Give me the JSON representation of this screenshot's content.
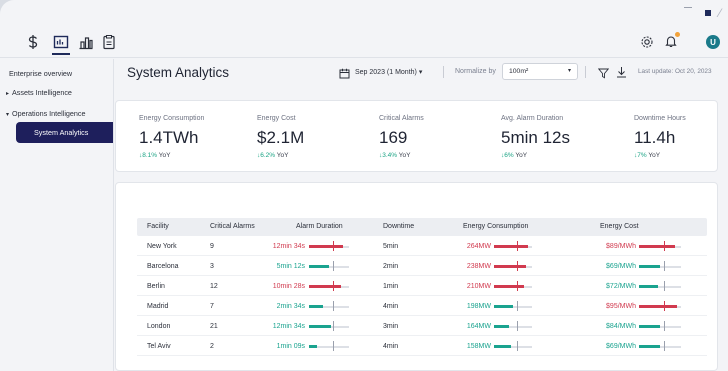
{
  "window": {
    "controls": {
      "close_glyph": "⁄"
    }
  },
  "nav": {
    "icons": [
      "dollar-icon",
      "dashboard-icon",
      "building-icon",
      "clipboard-icon"
    ],
    "active": "dashboard-icon",
    "avatar_initial": "U"
  },
  "sidebar": {
    "items": [
      {
        "label": "Enterprise overview"
      },
      {
        "label": "Assets Intelligence",
        "caret": "▸"
      },
      {
        "label": "Operations Intelligence",
        "caret": "▾"
      },
      {
        "label": "System Analytics",
        "active": true
      }
    ]
  },
  "header": {
    "title": "System Analytics",
    "date_range": "Sep 2023 (1 Month)",
    "date_caret": "▾",
    "normalize_label": "Normalize by",
    "normalize_value": "100m²",
    "normalize_caret": "▾",
    "last_update": "Last update: Oct 20, 2023"
  },
  "kpis": [
    {
      "label": "Energy Consumption",
      "value": "1.4TWh",
      "delta": "↓8.1%",
      "suffix": "YoY"
    },
    {
      "label": "Energy Cost",
      "value": "$2.1M",
      "delta": "↓6.2%",
      "suffix": "YoY"
    },
    {
      "label": "Critical Alarms",
      "value": "169",
      "delta": "↓3.4%",
      "suffix": "YoY"
    },
    {
      "label": "Avg. Alarm Duration",
      "value": "5min 12s",
      "delta": "↓6%",
      "suffix": "YoY"
    },
    {
      "label": "Downtime Hours",
      "value": "11.4h",
      "delta": "↓7%",
      "suffix": "YoY"
    }
  ],
  "table": {
    "columns": [
      "Facility",
      "Critical Alarms",
      "Alarm Duration",
      "Downtime",
      "Energy Consumption",
      "Energy Cost"
    ],
    "rows": [
      {
        "facility": "New York",
        "alarms": "9",
        "duration": "12min 34s",
        "duration_status": "bad",
        "duration_level": 0.85,
        "downtime": "5min",
        "energy": "264MW",
        "energy_status": "bad",
        "energy_level": 0.9,
        "cost": "$89/MWh",
        "cost_status": "bad",
        "cost_level": 0.85
      },
      {
        "facility": "Barcelona",
        "alarms": "3",
        "duration": "5min 12s",
        "duration_status": "good",
        "duration_level": 0.5,
        "downtime": "2min",
        "energy": "238MW",
        "energy_status": "bad",
        "energy_level": 0.85,
        "cost": "$69/MWh",
        "cost_status": "good",
        "cost_level": 0.5
      },
      {
        "facility": "Berlin",
        "alarms": "12",
        "duration": "10min 28s",
        "duration_status": "bad",
        "duration_level": 0.8,
        "downtime": "1min",
        "energy": "210MW",
        "energy_status": "bad",
        "energy_level": 0.8,
        "cost": "$72/MWh",
        "cost_status": "good",
        "cost_level": 0.45
      },
      {
        "facility": "Madrid",
        "alarms": "7",
        "duration": "2min 34s",
        "duration_status": "good",
        "duration_level": 0.35,
        "downtime": "4min",
        "energy": "198MW",
        "energy_status": "good",
        "energy_level": 0.5,
        "cost": "$95/MWh",
        "cost_status": "bad",
        "cost_level": 0.9
      },
      {
        "facility": "London",
        "alarms": "21",
        "duration": "12min 34s",
        "duration_status": "good",
        "duration_level": 0.55,
        "downtime": "3min",
        "energy": "164MW",
        "energy_status": "good",
        "energy_level": 0.4,
        "cost": "$84/MWh",
        "cost_status": "good",
        "cost_level": 0.5
      },
      {
        "facility": "Tel Aviv",
        "alarms": "2",
        "duration": "1min 09s",
        "duration_status": "good",
        "duration_level": 0.2,
        "downtime": "4min",
        "energy": "158MW",
        "energy_status": "good",
        "energy_level": 0.45,
        "cost": "$69/MWh",
        "cost_status": "good",
        "cost_level": 0.5
      }
    ]
  },
  "colors": {
    "bad": "#d13a4f",
    "good": "#1aa38f",
    "accent": "#1e1f5c"
  }
}
